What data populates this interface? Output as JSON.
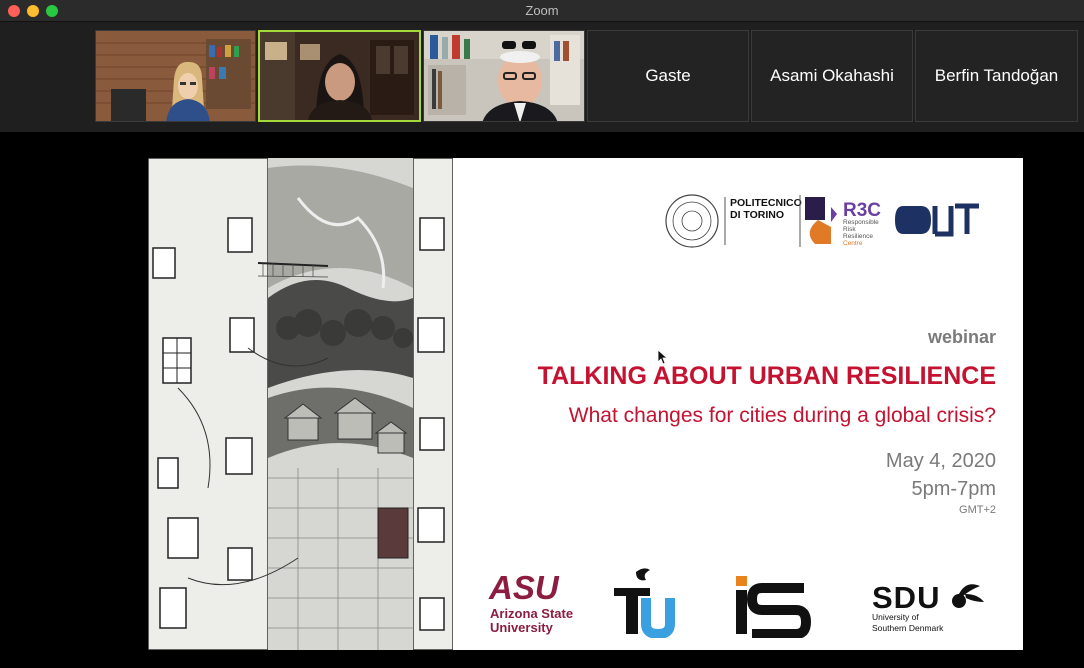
{
  "window": {
    "title": "Zoom"
  },
  "participants": [
    {
      "type": "video",
      "active": false
    },
    {
      "type": "video",
      "active": true
    },
    {
      "type": "video",
      "active": false
    },
    {
      "type": "name",
      "name": "Gaste"
    },
    {
      "type": "name",
      "name": "Asami Okahashi"
    },
    {
      "type": "name",
      "name": "Berfin Tandoğan"
    }
  ],
  "slide": {
    "top_logos": {
      "politecnico": "POLITECNICO\nDI TORINO",
      "r3c_big": "R3C",
      "r3c_lines": [
        "Responsible",
        "Risk",
        "Resilience",
        "Centre"
      ],
      "third": "INUT"
    },
    "label": "webinar",
    "title": "TALKING ABOUT URBAN RESILIENCE",
    "subtitle": "What changes for cities during a global crisis?",
    "date": "May 4, 2020",
    "time": "5pm-7pm",
    "timezone": "GMT+2",
    "bottom_logos": {
      "asu_mark": "ASU",
      "asu_text1": "Arizona State",
      "asu_text2": "University",
      "tu": "TU",
      "is": "iS",
      "sdu": "SDU",
      "sdu_text1": "University of",
      "sdu_text2": "Southern Denmark"
    },
    "colors": {
      "accent": "#c41230",
      "muted": "#7a7a7a"
    }
  }
}
